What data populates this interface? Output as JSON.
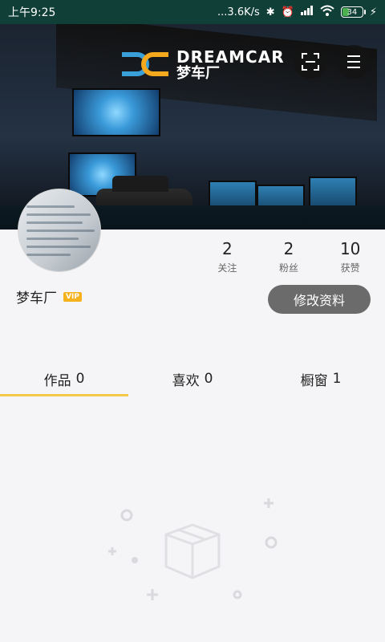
{
  "status_bar": {
    "time": "上午9:25",
    "network_speed": "...3.6K/s",
    "battery": "34",
    "battery_level": 0.34
  },
  "banner": {
    "logo_en": "DREAMCAR",
    "logo_cn": "梦车厂"
  },
  "header_actions": {
    "scan_icon": "scan-icon",
    "menu_icon": "menu-icon"
  },
  "profile": {
    "username": "梦车厂",
    "vip_badge": "VIP",
    "edit_button": "修改资料"
  },
  "stats": [
    {
      "value": "2",
      "label": "关注"
    },
    {
      "value": "2",
      "label": "粉丝"
    },
    {
      "value": "10",
      "label": "获赞"
    }
  ],
  "tabs": [
    {
      "label": "作品",
      "count": "0",
      "active": true
    },
    {
      "label": "喜欢",
      "count": "0",
      "active": false
    },
    {
      "label": "橱窗",
      "count": "1",
      "active": false
    }
  ],
  "colors": {
    "status_bar_bg": "#0f3f36",
    "tab_indicator": "#f7c948",
    "edit_button_bg": "#6b6b6b",
    "vip_badge": "#f6b21d"
  }
}
